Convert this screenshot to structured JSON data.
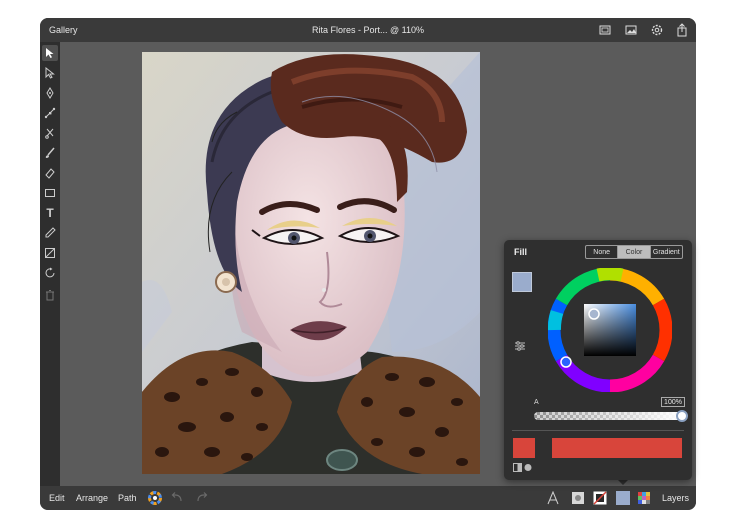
{
  "topbar": {
    "gallery": "Gallery",
    "title": "Rita Flores - Port... @ 110%",
    "icons": [
      "fullscreen-icon",
      "image-icon",
      "gear-icon",
      "share-icon"
    ]
  },
  "tools": [
    "select-icon",
    "direct-select-icon",
    "pen-icon",
    "node-icon",
    "scissors-icon",
    "brush-icon",
    "eraser-icon",
    "rectangle-icon",
    "text-icon",
    "eyedropper-icon",
    "image-tool-icon",
    "rotate-icon",
    "trash-icon"
  ],
  "bottombar": {
    "edit": "Edit",
    "arrange": "Arrange",
    "path": "Path",
    "layers": "Layers"
  },
  "fill": {
    "title": "Fill",
    "tabs": [
      "None",
      "Color",
      "Gradient"
    ],
    "selected_tab": "Color",
    "alpha_label": "A",
    "alpha_value": "100%",
    "alpha_fraction": 1.0,
    "current_color": "#d8453b",
    "stroke_swatch": "#9aaccc"
  }
}
